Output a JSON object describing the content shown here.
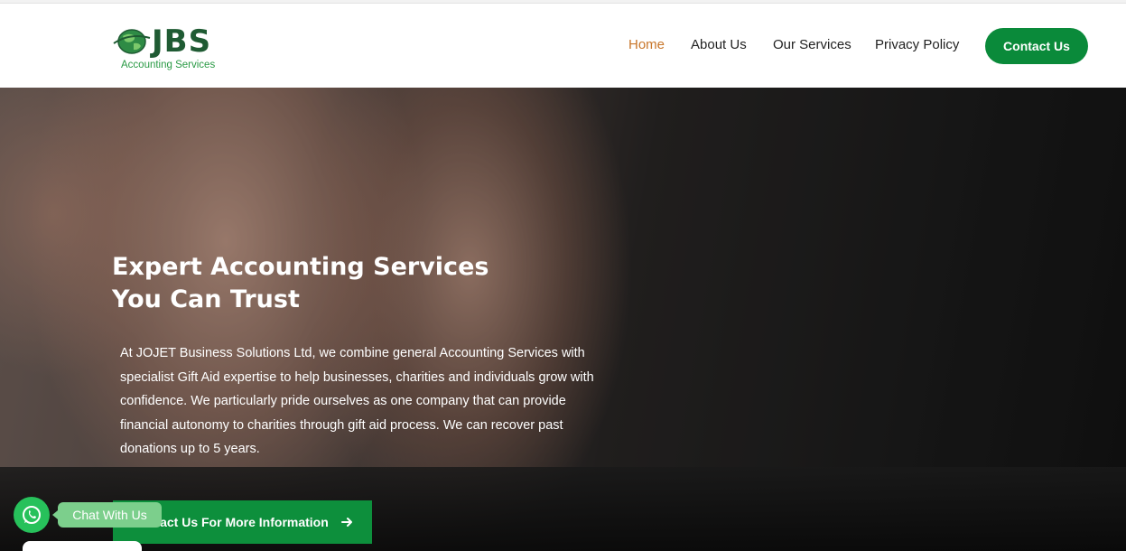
{
  "logo": {
    "brand": "JBS",
    "tagline": "Accounting Services",
    "icon": "globe-icon",
    "colors": {
      "brand": "#1f5b33",
      "tagline": "#2a9a45"
    }
  },
  "nav": {
    "items": [
      {
        "label": "Home",
        "active": true
      },
      {
        "label": "About Us",
        "active": false
      },
      {
        "label": "Our Services",
        "active": false
      },
      {
        "label": "Privacy Policy",
        "active": false
      }
    ],
    "cta_label": "Contact Us"
  },
  "hero": {
    "title_line1": "Expert Accounting Services",
    "title_line2": "You Can Trust",
    "body": "At JOJET Business Solutions Ltd, we combine general Accounting Services with specialist Gift Aid expertise to help businesses, charities and individuals grow with confidence.  We particularly pride ourselves as one company that can provide financial autonomy to charities through gift aid process. We can recover past donations up to 5 years.",
    "button_label": "Contact Us For More Information",
    "button_icon": "arrow-right-icon"
  },
  "chat_widget": {
    "label": "Chat With Us",
    "icon": "whatsapp-icon"
  },
  "colors": {
    "accent_green": "#0a8a3a",
    "active_nav": "#c8762a",
    "whatsapp": "#27c15b"
  }
}
